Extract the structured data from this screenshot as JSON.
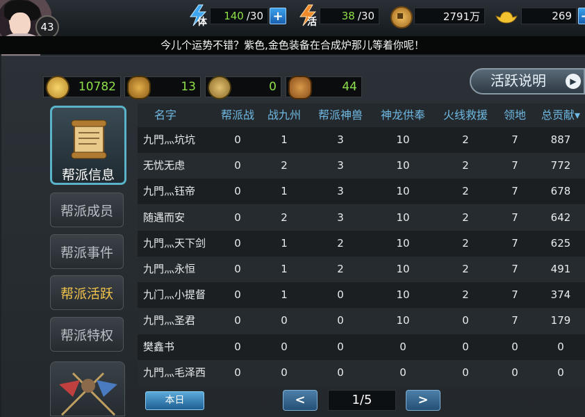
{
  "player": {
    "level": "43"
  },
  "stats": {
    "stamina": {
      "icon_label": "体",
      "value": "140",
      "max": "/30"
    },
    "vitality": {
      "icon_label": "活",
      "value": "38",
      "max": "/30"
    },
    "copper": {
      "value": "2791万"
    },
    "gold": {
      "value": "269"
    }
  },
  "notice": "今儿个运势不错？紫色,金色装备在合成炉那儿等着你呢！",
  "resources": [
    {
      "icon": "gold-medal-icon",
      "value": "10782"
    },
    {
      "icon": "lion-head-icon",
      "value": "13"
    },
    {
      "icon": "crossed-swords-badge-icon",
      "value": "0"
    },
    {
      "icon": "bronze-token-icon",
      "value": "44"
    }
  ],
  "activity_button": {
    "label": "活跃说明"
  },
  "sidebar": {
    "main": {
      "label": "帮派信息"
    },
    "items": [
      {
        "label": "帮派成员",
        "active": false
      },
      {
        "label": "帮派事件",
        "active": false
      },
      {
        "label": "帮派活跃",
        "active": true
      },
      {
        "label": "帮派特权",
        "active": false
      }
    ]
  },
  "table": {
    "headers": [
      "名字",
      "帮派战",
      "战九州",
      "帮派神兽",
      "神龙供奉",
      "火线救援",
      "领地",
      "总贡献▾"
    ],
    "rows": [
      [
        "九門灬坑坑",
        "0",
        "1",
        "3",
        "10",
        "2",
        "7",
        "887"
      ],
      [
        "无忧无虑",
        "0",
        "2",
        "3",
        "10",
        "2",
        "7",
        "772"
      ],
      [
        "九門灬钰帝",
        "0",
        "1",
        "3",
        "10",
        "2",
        "7",
        "678"
      ],
      [
        "随遇而安",
        "0",
        "2",
        "3",
        "10",
        "2",
        "7",
        "642"
      ],
      [
        "九門灬天下剑",
        "0",
        "1",
        "2",
        "10",
        "2",
        "7",
        "625"
      ],
      [
        "九門灬永恒",
        "0",
        "1",
        "2",
        "10",
        "2",
        "7",
        "491"
      ],
      [
        "九门灬小提督",
        "0",
        "1",
        "0",
        "10",
        "2",
        "7",
        "374"
      ],
      [
        "九門灬圣君",
        "0",
        "0",
        "0",
        "10",
        "0",
        "7",
        "179"
      ],
      [
        "樊鑫书",
        "0",
        "0",
        "0",
        "0",
        "0",
        "0",
        "0"
      ],
      [
        "九門灬毛泽西",
        "0",
        "0",
        "0",
        "0",
        "0",
        "0",
        "0"
      ]
    ]
  },
  "footer": {
    "today_label": "本日",
    "prev_label": "<",
    "next_label": ">",
    "page": "1/5"
  }
}
